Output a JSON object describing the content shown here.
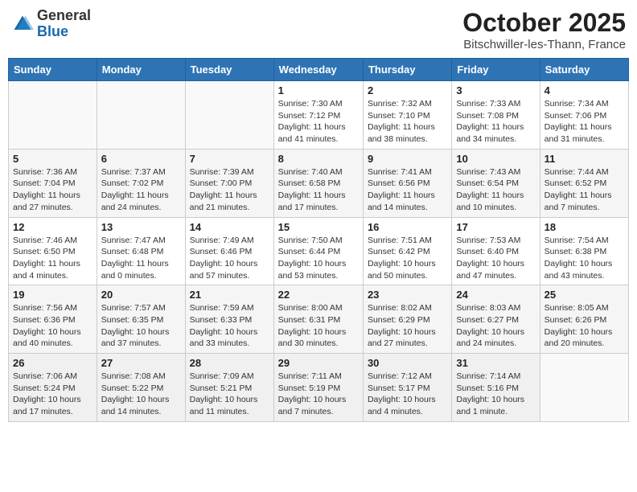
{
  "logo": {
    "general": "General",
    "blue": "Blue"
  },
  "title": "October 2025",
  "subtitle": "Bitschwiller-les-Thann, France",
  "weekdays": [
    "Sunday",
    "Monday",
    "Tuesday",
    "Wednesday",
    "Thursday",
    "Friday",
    "Saturday"
  ],
  "weeks": [
    [
      {
        "num": "",
        "info": ""
      },
      {
        "num": "",
        "info": ""
      },
      {
        "num": "",
        "info": ""
      },
      {
        "num": "1",
        "info": "Sunrise: 7:30 AM\nSunset: 7:12 PM\nDaylight: 11 hours and 41 minutes."
      },
      {
        "num": "2",
        "info": "Sunrise: 7:32 AM\nSunset: 7:10 PM\nDaylight: 11 hours and 38 minutes."
      },
      {
        "num": "3",
        "info": "Sunrise: 7:33 AM\nSunset: 7:08 PM\nDaylight: 11 hours and 34 minutes."
      },
      {
        "num": "4",
        "info": "Sunrise: 7:34 AM\nSunset: 7:06 PM\nDaylight: 11 hours and 31 minutes."
      }
    ],
    [
      {
        "num": "5",
        "info": "Sunrise: 7:36 AM\nSunset: 7:04 PM\nDaylight: 11 hours and 27 minutes."
      },
      {
        "num": "6",
        "info": "Sunrise: 7:37 AM\nSunset: 7:02 PM\nDaylight: 11 hours and 24 minutes."
      },
      {
        "num": "7",
        "info": "Sunrise: 7:39 AM\nSunset: 7:00 PM\nDaylight: 11 hours and 21 minutes."
      },
      {
        "num": "8",
        "info": "Sunrise: 7:40 AM\nSunset: 6:58 PM\nDaylight: 11 hours and 17 minutes."
      },
      {
        "num": "9",
        "info": "Sunrise: 7:41 AM\nSunset: 6:56 PM\nDaylight: 11 hours and 14 minutes."
      },
      {
        "num": "10",
        "info": "Sunrise: 7:43 AM\nSunset: 6:54 PM\nDaylight: 11 hours and 10 minutes."
      },
      {
        "num": "11",
        "info": "Sunrise: 7:44 AM\nSunset: 6:52 PM\nDaylight: 11 hours and 7 minutes."
      }
    ],
    [
      {
        "num": "12",
        "info": "Sunrise: 7:46 AM\nSunset: 6:50 PM\nDaylight: 11 hours and 4 minutes."
      },
      {
        "num": "13",
        "info": "Sunrise: 7:47 AM\nSunset: 6:48 PM\nDaylight: 11 hours and 0 minutes."
      },
      {
        "num": "14",
        "info": "Sunrise: 7:49 AM\nSunset: 6:46 PM\nDaylight: 10 hours and 57 minutes."
      },
      {
        "num": "15",
        "info": "Sunrise: 7:50 AM\nSunset: 6:44 PM\nDaylight: 10 hours and 53 minutes."
      },
      {
        "num": "16",
        "info": "Sunrise: 7:51 AM\nSunset: 6:42 PM\nDaylight: 10 hours and 50 minutes."
      },
      {
        "num": "17",
        "info": "Sunrise: 7:53 AM\nSunset: 6:40 PM\nDaylight: 10 hours and 47 minutes."
      },
      {
        "num": "18",
        "info": "Sunrise: 7:54 AM\nSunset: 6:38 PM\nDaylight: 10 hours and 43 minutes."
      }
    ],
    [
      {
        "num": "19",
        "info": "Sunrise: 7:56 AM\nSunset: 6:36 PM\nDaylight: 10 hours and 40 minutes."
      },
      {
        "num": "20",
        "info": "Sunrise: 7:57 AM\nSunset: 6:35 PM\nDaylight: 10 hours and 37 minutes."
      },
      {
        "num": "21",
        "info": "Sunrise: 7:59 AM\nSunset: 6:33 PM\nDaylight: 10 hours and 33 minutes."
      },
      {
        "num": "22",
        "info": "Sunrise: 8:00 AM\nSunset: 6:31 PM\nDaylight: 10 hours and 30 minutes."
      },
      {
        "num": "23",
        "info": "Sunrise: 8:02 AM\nSunset: 6:29 PM\nDaylight: 10 hours and 27 minutes."
      },
      {
        "num": "24",
        "info": "Sunrise: 8:03 AM\nSunset: 6:27 PM\nDaylight: 10 hours and 24 minutes."
      },
      {
        "num": "25",
        "info": "Sunrise: 8:05 AM\nSunset: 6:26 PM\nDaylight: 10 hours and 20 minutes."
      }
    ],
    [
      {
        "num": "26",
        "info": "Sunrise: 7:06 AM\nSunset: 5:24 PM\nDaylight: 10 hours and 17 minutes."
      },
      {
        "num": "27",
        "info": "Sunrise: 7:08 AM\nSunset: 5:22 PM\nDaylight: 10 hours and 14 minutes."
      },
      {
        "num": "28",
        "info": "Sunrise: 7:09 AM\nSunset: 5:21 PM\nDaylight: 10 hours and 11 minutes."
      },
      {
        "num": "29",
        "info": "Sunrise: 7:11 AM\nSunset: 5:19 PM\nDaylight: 10 hours and 7 minutes."
      },
      {
        "num": "30",
        "info": "Sunrise: 7:12 AM\nSunset: 5:17 PM\nDaylight: 10 hours and 4 minutes."
      },
      {
        "num": "31",
        "info": "Sunrise: 7:14 AM\nSunset: 5:16 PM\nDaylight: 10 hours and 1 minute."
      },
      {
        "num": "",
        "info": ""
      }
    ]
  ]
}
